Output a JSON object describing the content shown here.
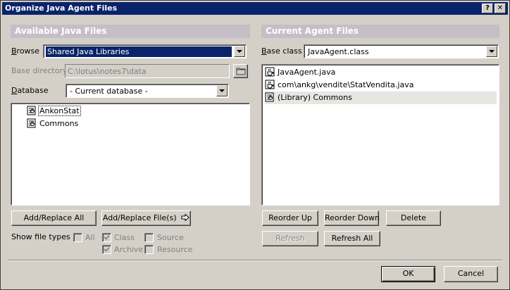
{
  "window": {
    "title": "Organize Java Agent Files",
    "help_glyph": "?",
    "close_glyph": "✕"
  },
  "left": {
    "header": "Available Java Files",
    "browse_label": "Browse",
    "browse_value": "Shared Java Libraries",
    "basedir_label": "Base directory",
    "basedir_value": "C:\\lotus\\notes7\\data",
    "database_label": "Database",
    "database_value": "- Current database -",
    "files": [
      {
        "name": "AnkonStat",
        "icon": "library-icon"
      },
      {
        "name": "Commons",
        "icon": "library-icon"
      }
    ],
    "add_replace_all": "Add/Replace All",
    "add_replace_files": "Add/Replace File(s)",
    "show_file_types_label": "Show file types",
    "types": {
      "all": "All",
      "class": "Class",
      "source": "Source",
      "archive": "Archive",
      "resource": "Resource"
    }
  },
  "right": {
    "header": "Current Agent Files",
    "base_class_label": "Base class",
    "base_class_value": "JavaAgent.class",
    "files": [
      {
        "name": "JavaAgent.java",
        "icon": "java-file-icon"
      },
      {
        "name": "com\\ankg\\vendite\\StatVendita.java",
        "icon": "java-file-icon"
      },
      {
        "name": "(Library) Commons",
        "icon": "library-icon"
      }
    ],
    "reorder_up": "Reorder Up",
    "reorder_down": "Reorder Down",
    "delete": "Delete",
    "refresh": "Refresh",
    "refresh_all": "Refresh All"
  },
  "footer": {
    "ok": "OK",
    "cancel": "Cancel"
  }
}
